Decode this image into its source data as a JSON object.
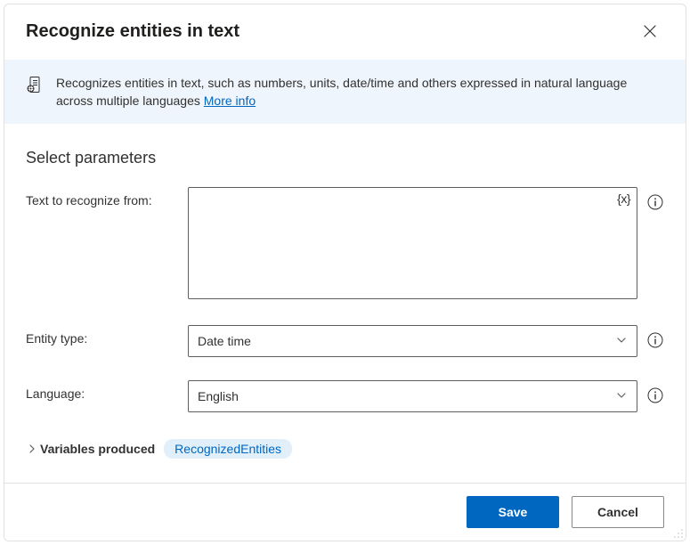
{
  "header": {
    "title": "Recognize entities in text"
  },
  "banner": {
    "text": "Recognizes entities in text, such as numbers, units, date/time and others expressed in natural language across multiple languages ",
    "more_link": "More info"
  },
  "section": {
    "title": "Select parameters"
  },
  "params": {
    "text_label": "Text to recognize from:",
    "text_value": "",
    "fx_label": "{x}",
    "entity_label": "Entity type:",
    "entity_value": "Date time",
    "lang_label": "Language:",
    "lang_value": "English"
  },
  "vars": {
    "label": "Variables produced",
    "chip": "RecognizedEntities"
  },
  "footer": {
    "save": "Save",
    "cancel": "Cancel"
  }
}
